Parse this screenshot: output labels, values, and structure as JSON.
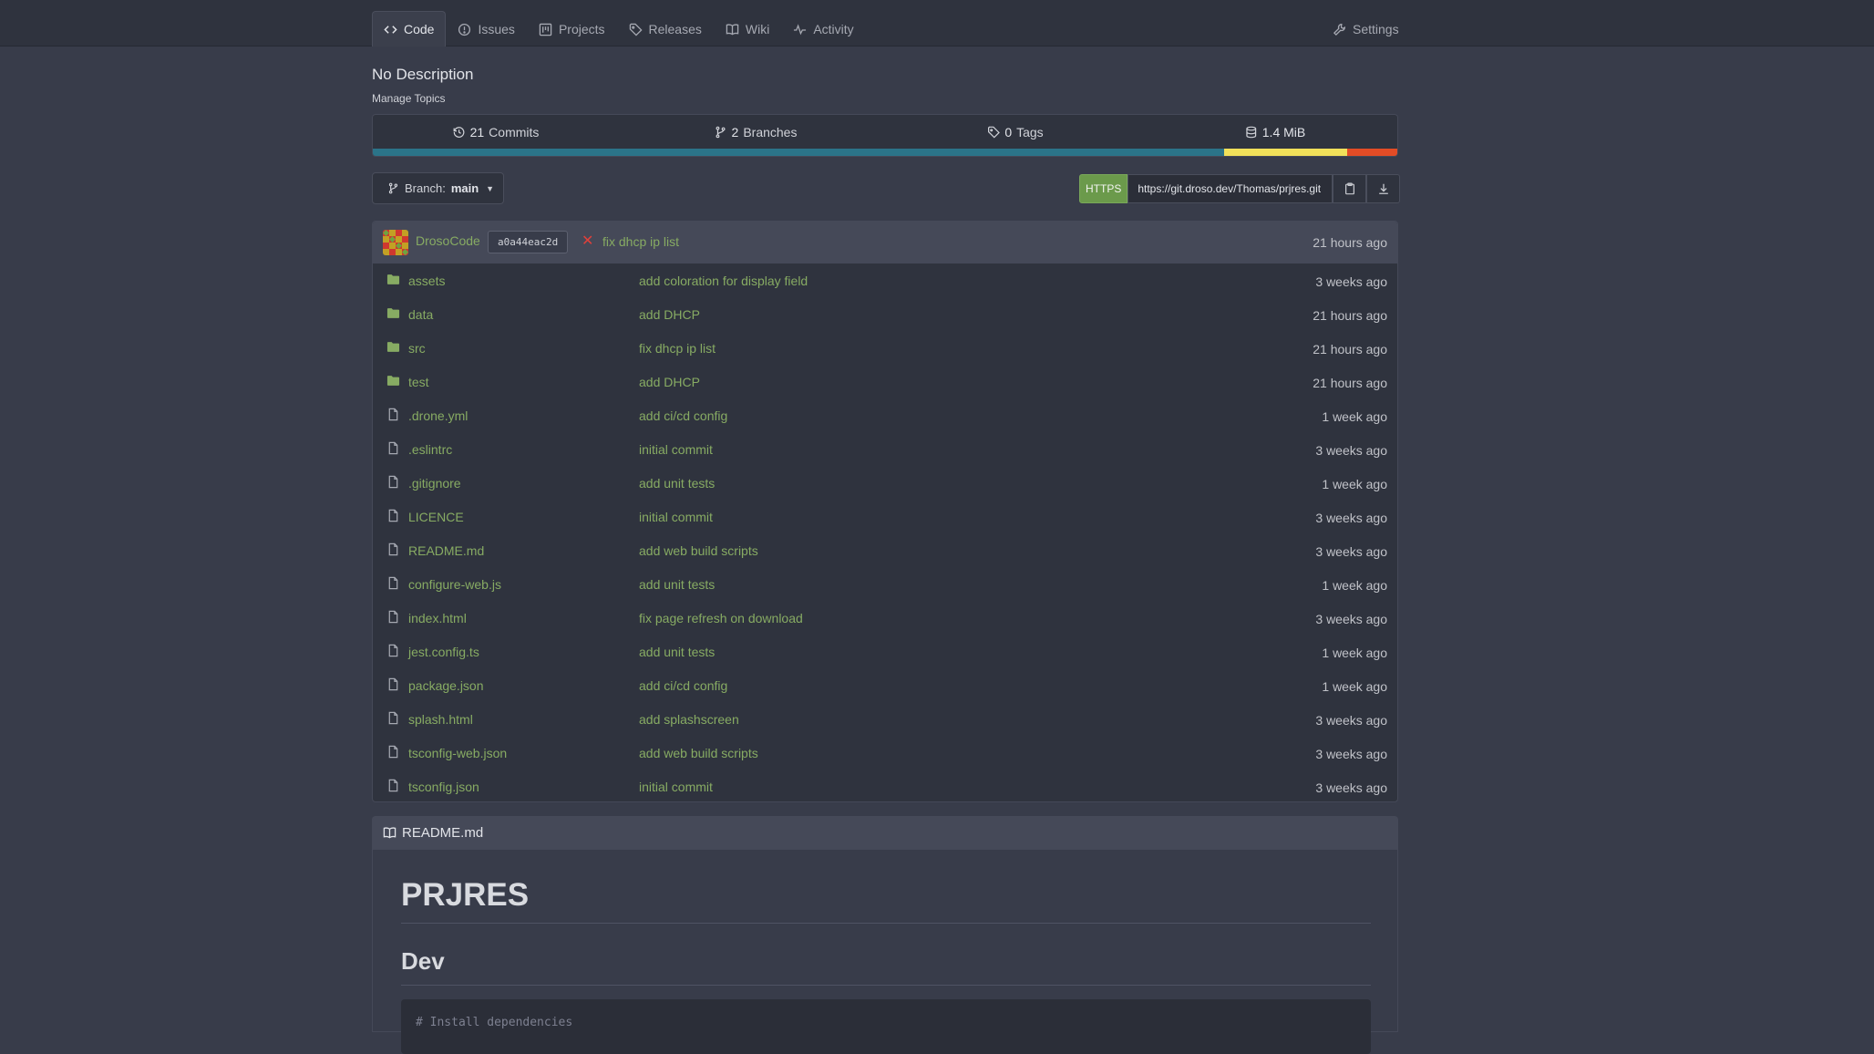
{
  "tabs": [
    {
      "label": "Code",
      "icon": "code-icon",
      "active": true
    },
    {
      "label": "Issues",
      "icon": "issue-icon"
    },
    {
      "label": "Projects",
      "icon": "project-icon"
    },
    {
      "label": "Releases",
      "icon": "tag-icon"
    },
    {
      "label": "Wiki",
      "icon": "book-icon"
    },
    {
      "label": "Activity",
      "icon": "pulse-icon"
    }
  ],
  "settings_label": "Settings",
  "repo": {
    "description": "No Description",
    "manage_topics": "Manage Topics"
  },
  "stats": {
    "commits_count": "21",
    "commits_label": "Commits",
    "branches_count": "2",
    "branches_label": "Branches",
    "tags_count": "0",
    "tags_label": "Tags",
    "size_value": "1.4 MiB"
  },
  "languages": [
    {
      "fraction": 0.831,
      "color": "#2b7489"
    },
    {
      "fraction": 0.12,
      "color": "#f1e05a"
    },
    {
      "fraction": 0.049,
      "color": "#e34c26"
    }
  ],
  "branch": {
    "prefix": "Branch:",
    "name": "main"
  },
  "clone": {
    "protocol": "HTTPS",
    "url": "https://git.droso.dev/Thomas/prjres.git"
  },
  "latest_commit": {
    "author": "DrosoCode",
    "sha": "a0a44eac2d",
    "message": "fix dhcp ip list",
    "time": "21 hours ago"
  },
  "files": [
    {
      "name": "assets",
      "type": "dir",
      "message": "add coloration for display field",
      "time": "3 weeks ago"
    },
    {
      "name": "data",
      "type": "dir",
      "message": "add DHCP",
      "time": "21 hours ago"
    },
    {
      "name": "src",
      "type": "dir",
      "message": "fix dhcp ip list",
      "time": "21 hours ago"
    },
    {
      "name": "test",
      "type": "dir",
      "message": "add DHCP",
      "time": "21 hours ago"
    },
    {
      "name": ".drone.yml",
      "type": "file",
      "message": "add ci/cd config",
      "time": "1 week ago"
    },
    {
      "name": ".eslintrc",
      "type": "file",
      "message": "initial commit",
      "time": "3 weeks ago"
    },
    {
      "name": ".gitignore",
      "type": "file",
      "message": "add unit tests",
      "time": "1 week ago"
    },
    {
      "name": "LICENCE",
      "type": "file",
      "message": "initial commit",
      "time": "3 weeks ago"
    },
    {
      "name": "README.md",
      "type": "file",
      "message": "add web build scripts",
      "time": "3 weeks ago"
    },
    {
      "name": "configure-web.js",
      "type": "file",
      "message": "add unit tests",
      "time": "1 week ago"
    },
    {
      "name": "index.html",
      "type": "file",
      "message": "fix page refresh on download",
      "time": "3 weeks ago"
    },
    {
      "name": "jest.config.ts",
      "type": "file",
      "message": "add unit tests",
      "time": "1 week ago"
    },
    {
      "name": "package.json",
      "type": "file",
      "message": "add ci/cd config",
      "time": "1 week ago"
    },
    {
      "name": "splash.html",
      "type": "file",
      "message": "add splashscreen",
      "time": "3 weeks ago"
    },
    {
      "name": "tsconfig-web.json",
      "type": "file",
      "message": "add web build scripts",
      "time": "3 weeks ago"
    },
    {
      "name": "tsconfig.json",
      "type": "file",
      "message": "initial commit",
      "time": "3 weeks ago"
    }
  ],
  "readme": {
    "filename": "README.md",
    "h1": "PRJRES",
    "h2": "Dev",
    "code_first_line": "# Install dependencies"
  }
}
